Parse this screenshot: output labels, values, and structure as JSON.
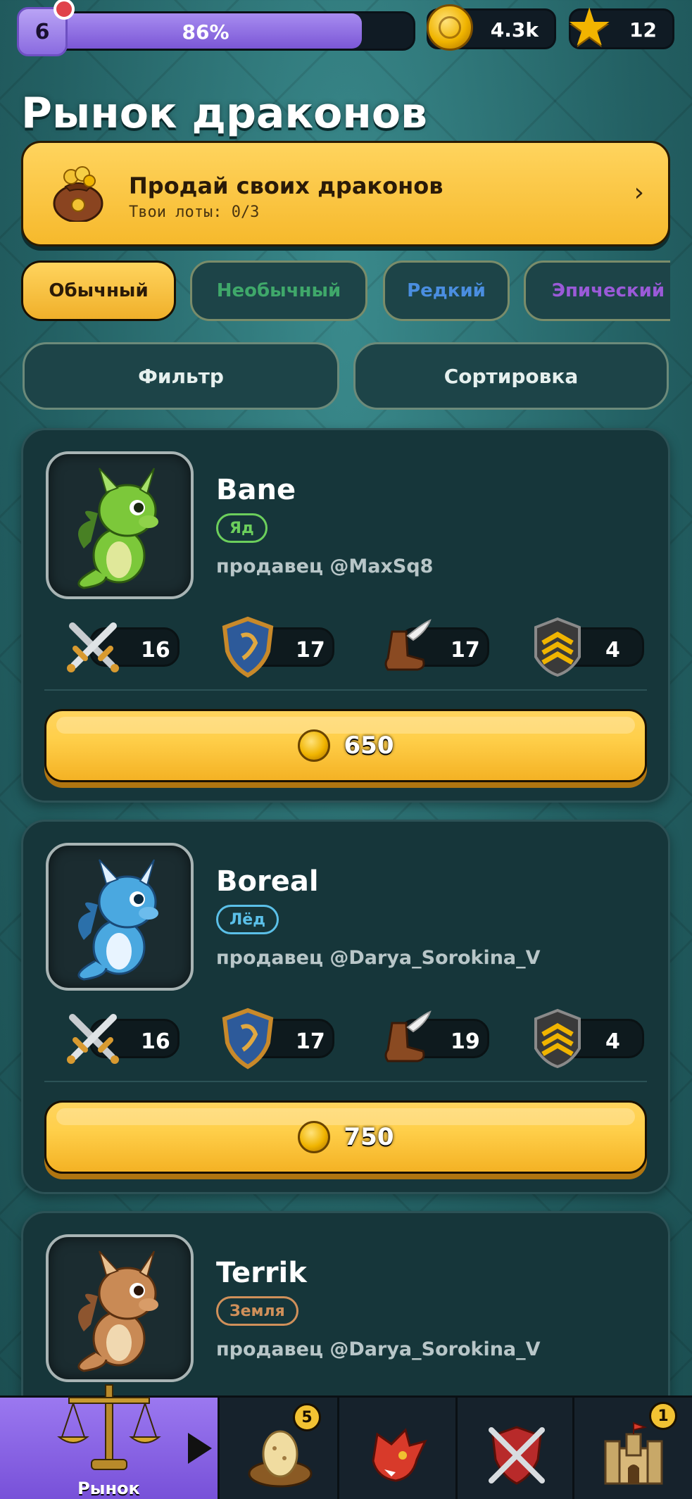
{
  "status_bar": {
    "level": "6",
    "xp_percent_label": "86%",
    "xp_fraction": 0.86,
    "coins": "4.3k",
    "stars": "12"
  },
  "title": "Рынок драконов",
  "sell_banner": {
    "title": "Продай своих драконов",
    "subtitle": "Твои лоты: 0/3",
    "chevron": "›",
    "icon": "money-bag-icon"
  },
  "rarity_tabs": [
    {
      "label": "Обычный",
      "color": "#2a1a08",
      "active": true
    },
    {
      "label": "Необычный",
      "color": "#3fa86a",
      "active": false
    },
    {
      "label": "Редкий",
      "color": "#4a8ee0",
      "active": false
    },
    {
      "label": "Эпический",
      "color": "#9a5ad8",
      "active": false
    }
  ],
  "controls": {
    "filter_label": "Фильтр",
    "sort_label": "Сортировка"
  },
  "dragons": [
    {
      "name": "Bane",
      "element": "Яд",
      "element_color": "#6ccf5c",
      "body_color": "#7cc83a",
      "seller": "продавец @MaxSq8",
      "attack": "16",
      "defense": "17",
      "speed": "17",
      "rank": "4",
      "price": "650"
    },
    {
      "name": "Boreal",
      "element": "Лёд",
      "element_color": "#5bc0e8",
      "body_color": "#4aa8e0",
      "seller": "продавец @Darya_Sorokina_V",
      "attack": "16",
      "defense": "17",
      "speed": "19",
      "rank": "4",
      "price": "750"
    },
    {
      "name": "Terrik",
      "element": "Земля",
      "element_color": "#d0905a",
      "body_color": "#c98a55",
      "seller": "продавец @Darya_Sorokina_V"
    }
  ],
  "bottom_nav": {
    "market_label": "Рынок",
    "eggs_badge": "5",
    "castle_badge": "1"
  }
}
